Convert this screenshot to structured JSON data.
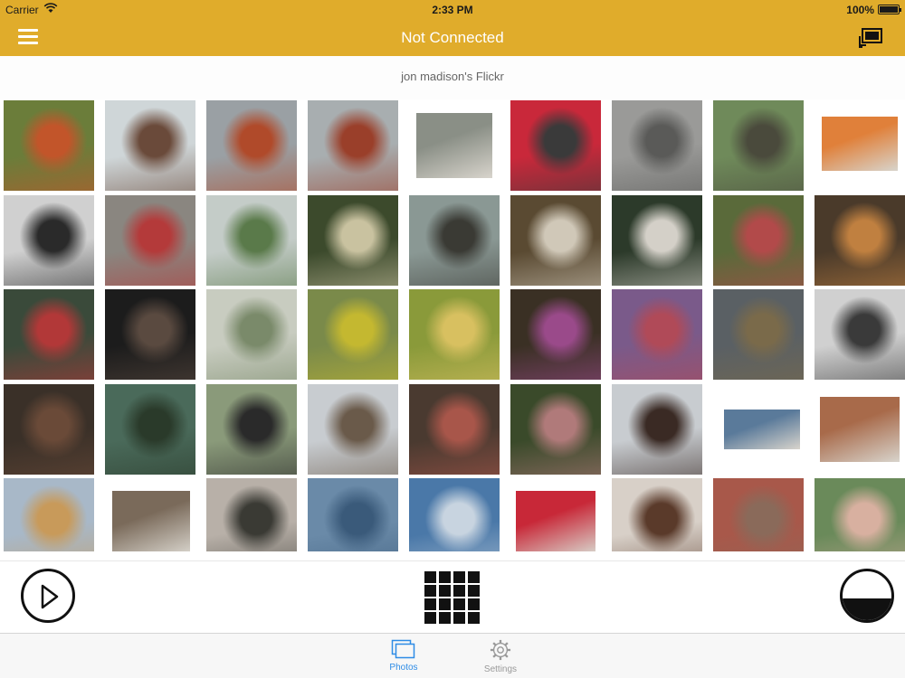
{
  "status": {
    "carrier": "Carrier",
    "time": "2:33 PM",
    "battery": "100%"
  },
  "nav": {
    "title": "Not Connected",
    "menu_icon": "hamburger-menu-icon",
    "cast_icon": "cast-screen-icon"
  },
  "gallery": {
    "title": "jon madison's Flickr",
    "selected_index": 0,
    "photo_count": 45
  },
  "controls": {
    "play_icon": "play-icon",
    "grid_icon": "grid-view-icon",
    "theme_icon": "half-circle-icon"
  },
  "tabs": [
    {
      "label": "Photos",
      "icon": "photos-icon",
      "active": true
    },
    {
      "label": "Settings",
      "icon": "gear-icon",
      "active": false
    }
  ],
  "colors": {
    "accent": "#e0ac2b",
    "tab_active": "#2e8ce6",
    "tab_inactive": "#999999"
  }
}
